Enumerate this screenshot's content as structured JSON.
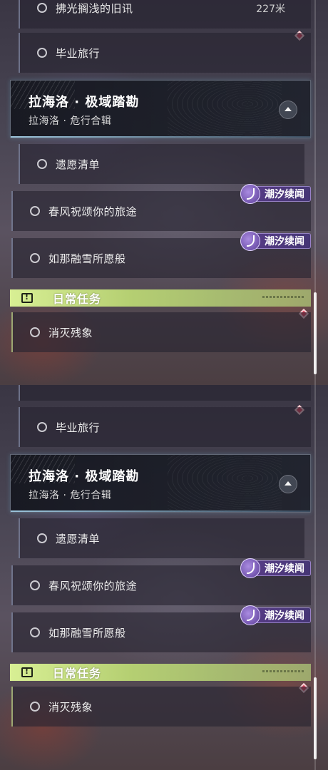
{
  "panels": [
    {
      "id": "top",
      "partial_row": {
        "label": "拂光搁浅的旧讯",
        "distance": "227米"
      },
      "rows_before_chapter": [
        {
          "label": "毕业旅行"
        }
      ],
      "chapter": {
        "title": "拉海洛 · 极域踏勘",
        "subtitle": "拉海洛 · 危行合辑"
      },
      "rows_after_chapter": [
        {
          "label": "遗愿清单"
        },
        {
          "label": "春风祝颂你的旅途",
          "badge": "潮汐续闻"
        },
        {
          "label": "如那融雪所愿般",
          "badge": "潮汐续闻"
        }
      ],
      "daily_header": "日常任务",
      "daily_rows": [
        {
          "label": "消灭残象"
        }
      ]
    },
    {
      "id": "bottom",
      "rows_before_chapter": [
        {
          "label": "毕业旅行"
        }
      ],
      "chapter": {
        "title": "拉海洛 · 极域踏勘",
        "subtitle": "拉海洛 · 危行合辑"
      },
      "rows_after_chapter": [
        {
          "label": "遗愿清单"
        },
        {
          "label": "春风祝颂你的旅途",
          "badge": "潮汐续闻"
        },
        {
          "label": "如那融雪所愿般",
          "badge": "潮汐续闻"
        }
      ],
      "daily_header": "日常任务",
      "daily_rows": [
        {
          "label": "消灭残象"
        }
      ]
    }
  ],
  "colors": {
    "daily_accent": "#c8e27f",
    "badge_purple": "#5a3c8c",
    "tracked_marker": "#e0405a"
  },
  "icons": [
    "radio-circle-icon",
    "collapse-arrow-icon",
    "tide-story-icon",
    "daily-quest-icon",
    "tracked-diamond-icon"
  ]
}
